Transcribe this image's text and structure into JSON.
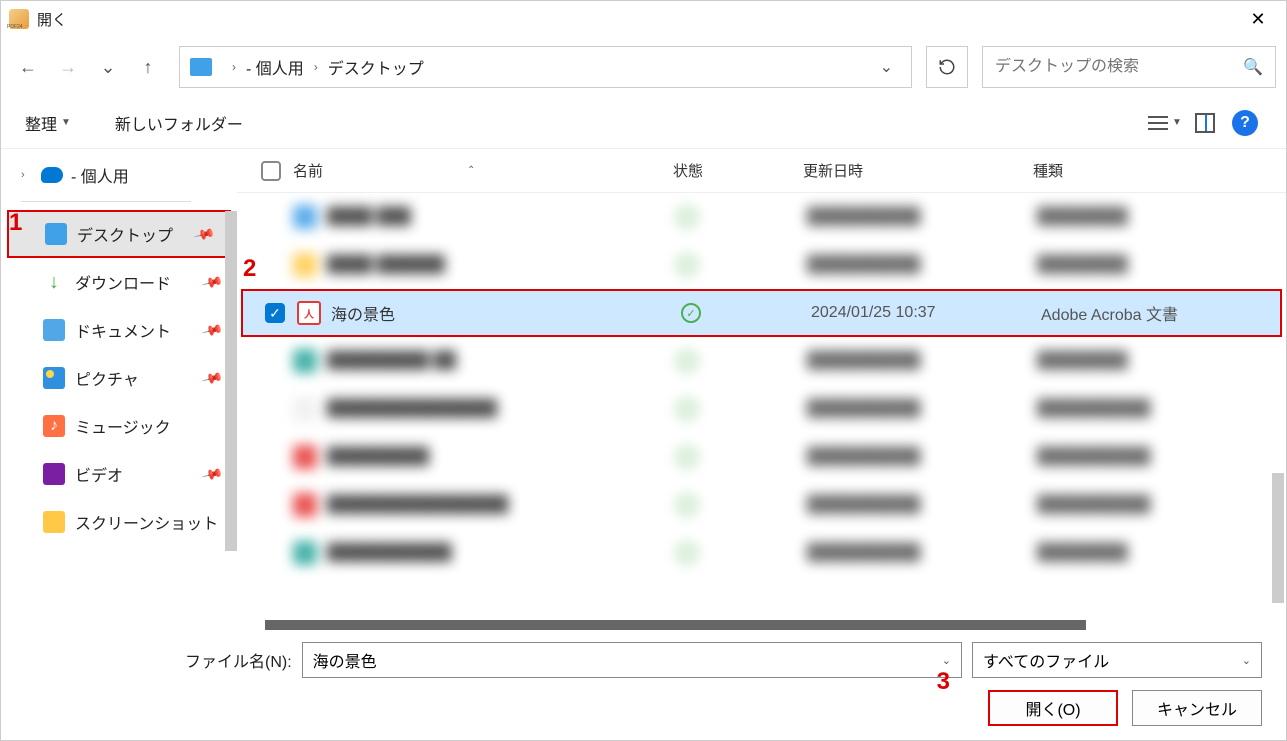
{
  "window": {
    "title": "開く"
  },
  "nav": {
    "breadcrumb": [
      "- 個人用",
      "デスクトップ"
    ],
    "search_placeholder": "デスクトップの検索"
  },
  "toolbar": {
    "organize": "整理",
    "new_folder": "新しいフォルダー"
  },
  "sidebar": {
    "onedrive_suffix": "- 個人用",
    "quick": [
      {
        "label": "デスクトップ",
        "icon": "desktop",
        "pinned": true,
        "selected": true
      },
      {
        "label": "ダウンロード",
        "icon": "download",
        "pinned": true
      },
      {
        "label": "ドキュメント",
        "icon": "document",
        "pinned": true
      },
      {
        "label": "ピクチャ",
        "icon": "picture",
        "pinned": true
      },
      {
        "label": "ミュージック",
        "icon": "music",
        "pinned": false
      },
      {
        "label": "ビデオ",
        "icon": "video",
        "pinned": true
      },
      {
        "label": "スクリーンショット",
        "icon": "folder",
        "pinned": false
      }
    ]
  },
  "file_header": {
    "name": "名前",
    "state": "状態",
    "date": "更新日時",
    "type": "種類"
  },
  "selected_file": {
    "name": "海の景色",
    "date": "2024/01/25 10:37",
    "type": "Adobe Acroba 文書"
  },
  "footer": {
    "filename_label": "ファイル名(N):",
    "filename_value": "海の景色",
    "filter_label": "すべてのファイル",
    "open_btn": "開く(O)",
    "cancel_btn": "キャンセル"
  },
  "annotations": {
    "a1": "1",
    "a2": "2",
    "a3": "3"
  }
}
